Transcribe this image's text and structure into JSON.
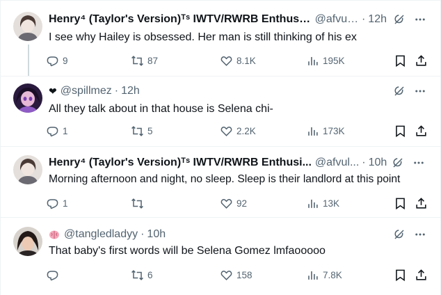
{
  "tweets": [
    {
      "name": "Henry⁴ (Taylor's Version)ᵀˢ IWTV/RWRB Enthusi...",
      "handle": "@afvul...",
      "time": "12h",
      "text": "I see why Hailey is obsessed. Her man is still thinking of his ex",
      "replies": "9",
      "reposts": "87",
      "likes": "8.1K",
      "views": "195K",
      "avatar_color": "#d9d4cf"
    },
    {
      "name": "",
      "prefix_glyph": "❤",
      "handle": "@spillmez",
      "time": "12h",
      "text": "All they talk about in that house is Selena chi-",
      "replies": "1",
      "reposts": "5",
      "likes": "2.2K",
      "views": "173K",
      "avatar_color": "#5a3a7a"
    },
    {
      "name": "Henry⁴ (Taylor's Version)ᵀˢ IWTV/RWRB Enthusi...",
      "handle": "@afvul...",
      "time": "10h",
      "text": "Morning afternoon and night, no sleep. Sleep is their landlord at this point",
      "replies": "1",
      "reposts": "",
      "likes": "92",
      "views": "13K",
      "avatar_color": "#d9d4cf"
    },
    {
      "name": "",
      "handle": "@tangledladyy",
      "time": "10h",
      "text": "That baby's first words will be Selena Gomez lmfaooooo",
      "replies": "",
      "reposts": "6",
      "likes": "158",
      "views": "7.8K",
      "avatar_color": "#3a3030"
    }
  ],
  "colors": {
    "text_primary": "#0f1419",
    "text_secondary": "#536471",
    "separator": "#eff3f4",
    "thread_line": "#cfd9de"
  },
  "icons": [
    "reply-icon",
    "repost-icon",
    "like-icon",
    "views-icon",
    "bookmark-icon",
    "share-icon",
    "grok-icon",
    "more-icon",
    "heart-emoji",
    "brain-emoji"
  ]
}
